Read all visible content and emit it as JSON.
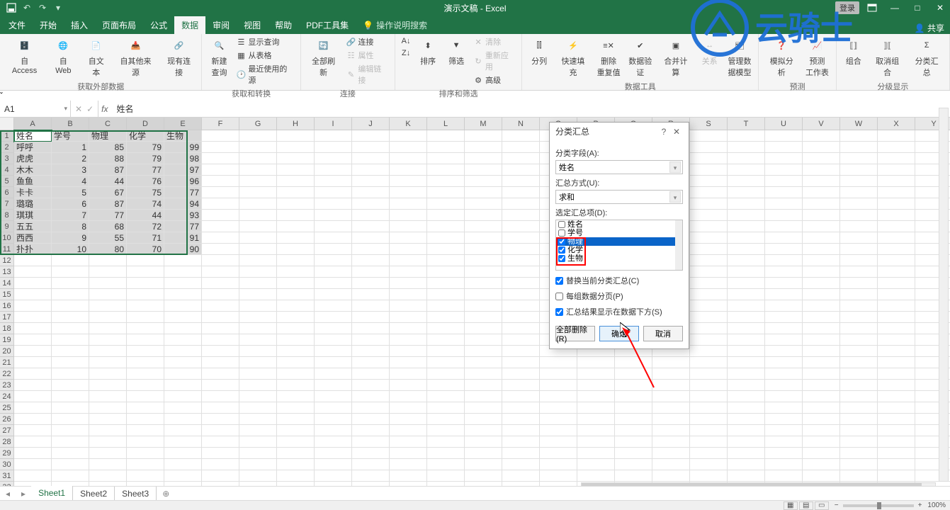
{
  "titlebar": {
    "doc": "演示文稿 - Excel",
    "login": "登录"
  },
  "tabs": {
    "file": "文件",
    "home": "开始",
    "insert": "插入",
    "layout": "页面布局",
    "formula": "公式",
    "data": "数据",
    "review": "审阅",
    "view": "视图",
    "help": "帮助",
    "pdf": "PDF工具集",
    "tell": "操作说明搜索",
    "share": "共享"
  },
  "ribbon": {
    "ext": {
      "access": "自 Access",
      "web": "自 Web",
      "text": "自文本",
      "other": "自其他来源",
      "existing": "现有连接",
      "group": "获取外部数据"
    },
    "get": {
      "newq": "新建\n查询",
      "show": "显示查询",
      "fromtable": "从表格",
      "recent": "最近使用的源",
      "group": "获取和转换"
    },
    "conn": {
      "refresh": "全部刷新",
      "connections": "连接",
      "properties": "属性",
      "editlinks": "编辑链接",
      "group": "连接"
    },
    "sort": {
      "az": "A→Z",
      "za": "Z→A",
      "sort": "排序",
      "filter": "筛选",
      "clear": "清除",
      "reapply": "重新应用",
      "advanced": "高级",
      "group": "排序和筛选"
    },
    "tools": {
      "t2c": "分列",
      "flash": "快速填充",
      "dedup": "删除\n重复值",
      "valid": "数据验\n证",
      "consol": "合并计算",
      "relation": "关系",
      "model": "管理数\n据模型",
      "group": "数据工具"
    },
    "forecast": {
      "whatif": "模拟分析",
      "forecast": "预测\n工作表",
      "group": "预测"
    },
    "outline": {
      "grp": "组合",
      "ungrp": "取消组合",
      "subtotal": "分类汇总",
      "group": "分级显示"
    }
  },
  "namebox": "A1",
  "formula": "姓名",
  "cols": [
    "A",
    "B",
    "C",
    "D",
    "E",
    "F",
    "G",
    "H",
    "I",
    "J",
    "K",
    "L",
    "M",
    "N",
    "O",
    "P",
    "Q",
    "R",
    "S",
    "T",
    "U",
    "V",
    "W",
    "X",
    "Y"
  ],
  "table": {
    "headers": [
      "姓名",
      "学号",
      "物理",
      "化学",
      "生物"
    ],
    "rows": [
      [
        "呼呼",
        "1",
        "85",
        "79",
        "99"
      ],
      [
        "虎虎",
        "2",
        "88",
        "79",
        "98"
      ],
      [
        "木木",
        "3",
        "87",
        "77",
        "97"
      ],
      [
        "鱼鱼",
        "4",
        "44",
        "76",
        "96"
      ],
      [
        "卡卡",
        "5",
        "67",
        "75",
        "77"
      ],
      [
        "璐璐",
        "6",
        "87",
        "74",
        "94"
      ],
      [
        "琪琪",
        "7",
        "77",
        "44",
        "93"
      ],
      [
        "五五",
        "8",
        "68",
        "72",
        "77"
      ],
      [
        "西西",
        "9",
        "55",
        "71",
        "91"
      ],
      [
        "扑扑",
        "10",
        "80",
        "70",
        "90"
      ]
    ]
  },
  "dialog": {
    "title": "分类汇总",
    "fieldLabel": "分类字段(A):",
    "fieldValue": "姓名",
    "funcLabel": "汇总方式(U):",
    "funcValue": "求和",
    "itemsLabel": "选定汇总项(D):",
    "items": {
      "name": "姓名",
      "id": "学号",
      "phy": "物理",
      "chem": "化学",
      "bio": "生物"
    },
    "opt1": "替换当前分类汇总(C)",
    "opt2": "每组数据分页(P)",
    "opt3": "汇总结果显示在数据下方(S)",
    "btnRemove": "全部删除(R)",
    "btnOk": "确定",
    "btnCancel": "取消"
  },
  "sheets": {
    "s1": "Sheet1",
    "s2": "Sheet2",
    "s3": "Sheet3"
  },
  "zoom": "100%",
  "watermark": "云骑士"
}
